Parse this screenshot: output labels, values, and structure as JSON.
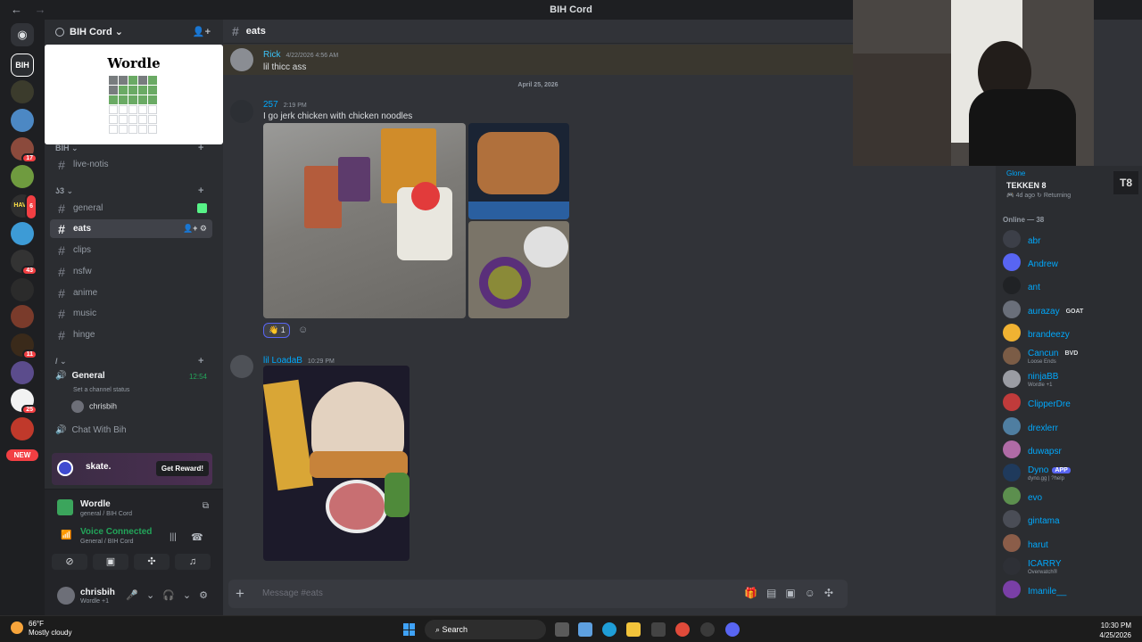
{
  "titlebar": {
    "title": "BIH Cord",
    "back": "←",
    "forward": "→"
  },
  "servers": {
    "badges": [
      "17",
      "6",
      "43",
      "11",
      "25"
    ],
    "new_label": "NEW"
  },
  "server": {
    "name": "BIH Cord ⌄"
  },
  "wordle_card": {
    "title": "Wordle"
  },
  "categories": {
    "first": "BIH ⌄",
    "second": "ʖ3 ⌄",
    "third": "/ ⌄"
  },
  "channels": {
    "live_notis": "live-notis",
    "general": "general",
    "eats": "eats",
    "clips": "clips",
    "nsfw": "nsfw",
    "anime": "anime",
    "music": "music",
    "hinge": "hinge"
  },
  "voice": {
    "name": "General",
    "timer": "12:54",
    "status_prompt": "Set a channel status",
    "member": "chrisbih",
    "second_channel": "Chat With Bih"
  },
  "activity_banner": {
    "name": "skate.",
    "button": "Get Reward!"
  },
  "panel": {
    "activity_name": "Wordle",
    "activity_sub": "general / BIH Cord",
    "voice_connected": "Voice Connected",
    "voice_sub": "General / BIH Cord",
    "username": "chrisbih",
    "user_status": "Wordle +1"
  },
  "chat": {
    "channel": "eats",
    "messages": [
      {
        "author": "Rick",
        "time": "4/22/2026 4:56 AM",
        "text": "lil thicc ass"
      },
      {
        "author": "257",
        "time": "2:19 PM",
        "text": "I go jerk chicken with chicken noodles"
      },
      {
        "author": "lil LoadaB",
        "time": "10:29 PM",
        "text": ""
      }
    ],
    "date_separator": "April 25, 2026",
    "reaction": {
      "emoji": "👋",
      "count": "1"
    },
    "composer_placeholder": "Message #eats"
  },
  "game": {
    "player": "Glone",
    "name": "TEKKEN 8",
    "status": "🎮 4d ago  ↻ Returning",
    "logo": "T8"
  },
  "members": {
    "online_label": "Online — 38",
    "list": [
      {
        "name": "abr",
        "sub": "",
        "tag": "",
        "color": "#3c3f48"
      },
      {
        "name": "Andrew",
        "sub": "",
        "tag": "",
        "color": "#5865f2"
      },
      {
        "name": "ant",
        "sub": "",
        "tag": "",
        "color": "#202225"
      },
      {
        "name": "aurazay",
        "sub": "",
        "tag": "GOAT",
        "color": "#6a6f7a"
      },
      {
        "name": "brandeezy",
        "sub": "",
        "tag": "",
        "color": "#f0b232"
      },
      {
        "name": "Cancun",
        "sub": "Loose Ends",
        "tag": "BVD",
        "color": "#7b5c46"
      },
      {
        "name": "ninjaBB",
        "sub": "Wordle +1",
        "tag": "",
        "color": "#9a9ca3"
      },
      {
        "name": "ClipperDre",
        "sub": "",
        "tag": "",
        "color": "#c03b3b"
      },
      {
        "name": "drexlerr",
        "sub": "",
        "tag": "",
        "color": "#4f7ea1"
      },
      {
        "name": "duwapsr",
        "sub": "",
        "tag": "",
        "color": "#b06ba6"
      },
      {
        "name": "Dyno",
        "sub": "dyno.gg | ?help",
        "tag": "APP",
        "color": "#1f3a5c"
      },
      {
        "name": "evo",
        "sub": "",
        "tag": "",
        "color": "#5c8f4e"
      },
      {
        "name": "gintama",
        "sub": "",
        "tag": "",
        "color": "#4a4d56"
      },
      {
        "name": "harut",
        "sub": "",
        "tag": "",
        "color": "#8b5d49"
      },
      {
        "name": "ICARRY",
        "sub": "Overwatch®",
        "tag": "",
        "color": "#2e3036"
      },
      {
        "name": "Imanile__",
        "sub": "",
        "tag": "",
        "color": "#7a3fa6"
      }
    ]
  },
  "taskbar": {
    "temp": "66°F",
    "weather": "Mostly cloudy",
    "search": "Search",
    "time": "10:30 PM",
    "date": "4/25/2026"
  }
}
